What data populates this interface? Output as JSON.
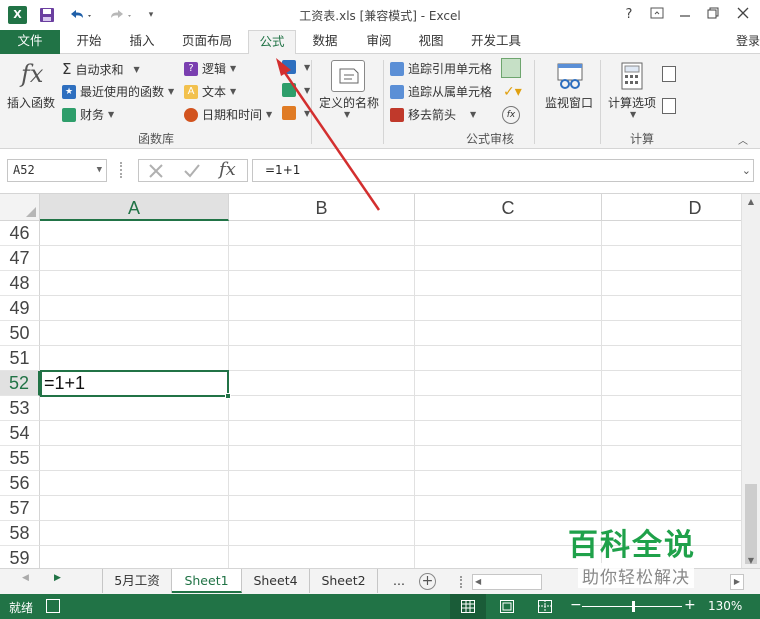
{
  "window": {
    "title": "工资表.xls  [兼容模式] - Excel",
    "help": "?",
    "logo_text": "X"
  },
  "tabs": {
    "file": "文件",
    "items": [
      "开始",
      "插入",
      "页面布局",
      "公式",
      "数据",
      "审阅",
      "视图",
      "开发工具"
    ],
    "active": "公式",
    "login": "登录"
  },
  "ribbon": {
    "insert_function": "插入函数",
    "autosum": "自动求和",
    "recent": "最近使用的函数",
    "financial": "财务",
    "logical": "逻辑",
    "text": "文本",
    "datetime": "日期和时间",
    "group_function_library": "函数库",
    "defined_names": "定义的名称",
    "trace_precedents": "追踪引用单元格",
    "trace_dependents": "追踪从属单元格",
    "remove_arrows": "移去箭头",
    "group_formula_auditing": "公式审核",
    "watch_window": "监视窗口",
    "calc_options": "计算选项",
    "group_calculation": "计算"
  },
  "formula_bar": {
    "name_box": "A52",
    "formula": "=1+1",
    "fx": "fx"
  },
  "grid": {
    "columns": [
      "A",
      "B",
      "C",
      "D"
    ],
    "selected_column": "A",
    "rows": [
      "46",
      "47",
      "48",
      "49",
      "50",
      "51",
      "52",
      "53",
      "54",
      "55",
      "56",
      "57",
      "58",
      "59"
    ],
    "selected_row": "52",
    "active_cell_value": "=1+1"
  },
  "sheets": {
    "tabs": [
      "5月工资",
      "Sheet1",
      "Sheet4",
      "Sheet2"
    ],
    "active": "Sheet1",
    "more": "..."
  },
  "status": {
    "mode": "就绪",
    "zoom": "130%"
  },
  "watermark": {
    "line1": "百科全说",
    "line2": "助你轻松解决"
  },
  "colors": {
    "accent": "#217346",
    "arrow": "#d32f2f"
  }
}
